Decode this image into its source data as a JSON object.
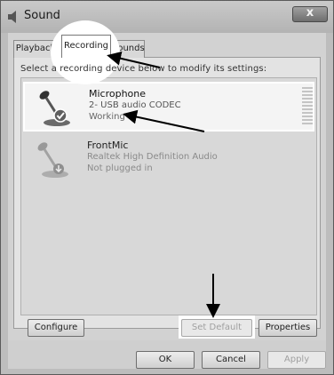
{
  "window": {
    "title": "Sound",
    "close_label": "x"
  },
  "tabs": [
    {
      "label": "Playback",
      "active": false
    },
    {
      "label": "Recording",
      "active": true
    },
    {
      "label": "Sounds",
      "active": false
    }
  ],
  "instructions": "Select a recording device below to modify its settings:",
  "devices": [
    {
      "name": "Microphone",
      "description": "2- USB audio CODEC",
      "status": "Working",
      "selected": true,
      "icon": "microphone-icon"
    },
    {
      "name": "FrontMic",
      "description": "Realtek High Definition Audio",
      "status": "Not plugged in",
      "selected": false,
      "icon": "microphone-icon"
    }
  ],
  "buttons": {
    "configure": "Configure",
    "set_default": "Set Default",
    "properties": "Properties",
    "ok": "OK",
    "cancel": "Cancel",
    "apply": "Apply"
  },
  "colors": {
    "highlight": "#ffffff",
    "annotation_arrow": "#000000"
  }
}
